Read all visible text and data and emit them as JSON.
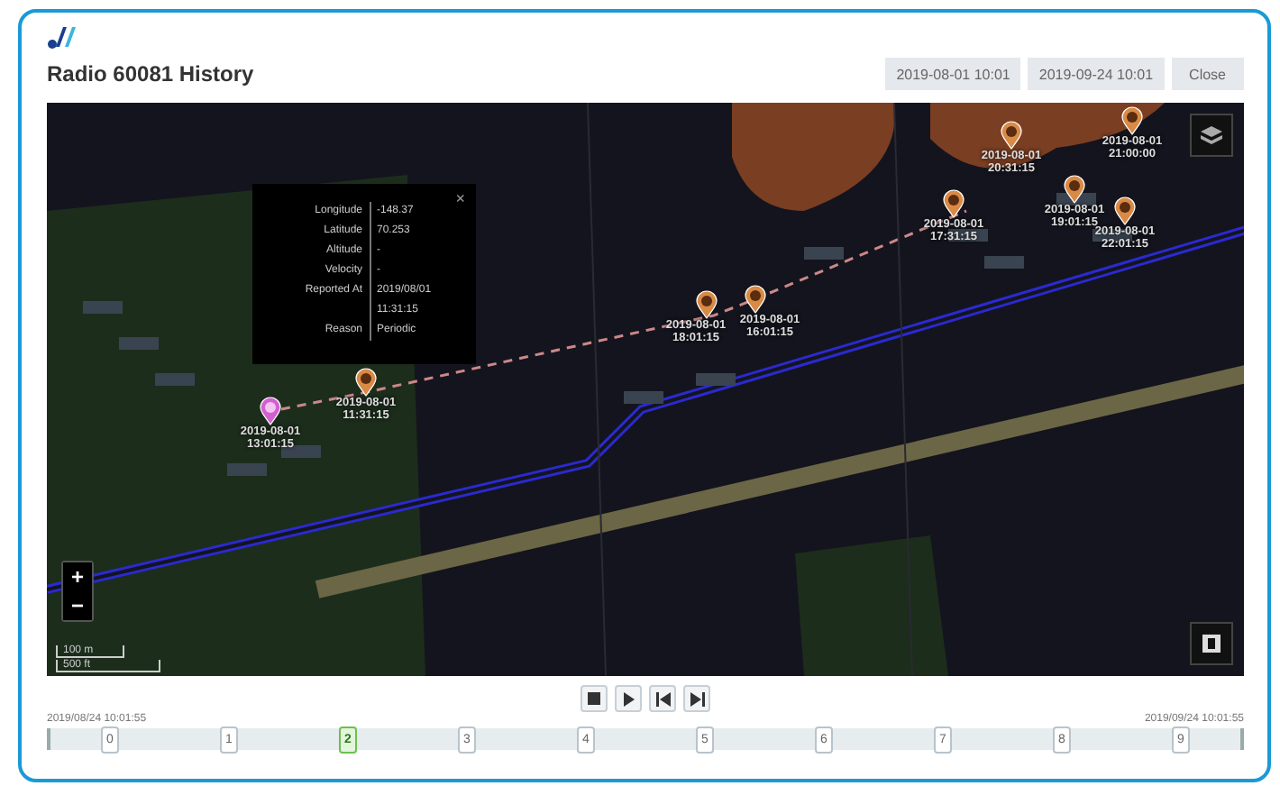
{
  "header": {
    "title": "Radio 60081 History",
    "buttons": [
      "2019-08-01 10:01",
      "2019-09-24 10:01",
      "Close"
    ]
  },
  "popup": {
    "close": "×",
    "rows": [
      {
        "label": "Longitude",
        "value": "-148.37"
      },
      {
        "label": "Latitude",
        "value": "70.253"
      },
      {
        "label": "Altitude",
        "value": "-"
      },
      {
        "label": "Velocity",
        "value": "-"
      },
      {
        "label": "Reported At",
        "value": "2019/08/01 11:31:15"
      },
      {
        "label": "Reason",
        "value": "Periodic"
      }
    ]
  },
  "markers": [
    {
      "kind": "start",
      "date": "2019-08-01",
      "time": "13:01:15"
    },
    {
      "kind": "point",
      "date": "2019-08-01",
      "time": "11:31:15"
    },
    {
      "kind": "point",
      "date": "2019-08-01",
      "time": "18:01:15"
    },
    {
      "kind": "point",
      "date": "2019-08-01",
      "time": "16:01:15"
    },
    {
      "kind": "point",
      "date": "2019-08-01",
      "time": "17:31:15"
    },
    {
      "kind": "point",
      "date": "2019-08-01",
      "time": "19:01:15"
    },
    {
      "kind": "point",
      "date": "2019-08-01",
      "time": "22:01:15"
    },
    {
      "kind": "point",
      "date": "2019-08-01",
      "time": "20:31:15"
    },
    {
      "kind": "point",
      "date": "2019-08-01",
      "time": "21:00:00"
    }
  ],
  "zoom": [
    "+",
    "−"
  ],
  "scale": [
    "100 m",
    "500 ft"
  ],
  "timeline": {
    "start": "2019/08/24 10:01:55",
    "end": "2019/09/24 10:01:55",
    "ticks": [
      {
        "label": "0",
        "selected": false
      },
      {
        "label": "1",
        "selected": false
      },
      {
        "label": "2",
        "selected": true
      },
      {
        "label": "3",
        "selected": false
      },
      {
        "label": "4",
        "selected": false
      },
      {
        "label": "5",
        "selected": false
      },
      {
        "label": "6",
        "selected": false
      },
      {
        "label": "7",
        "selected": false
      },
      {
        "label": "8",
        "selected": false
      },
      {
        "label": "9",
        "selected": false
      }
    ]
  }
}
